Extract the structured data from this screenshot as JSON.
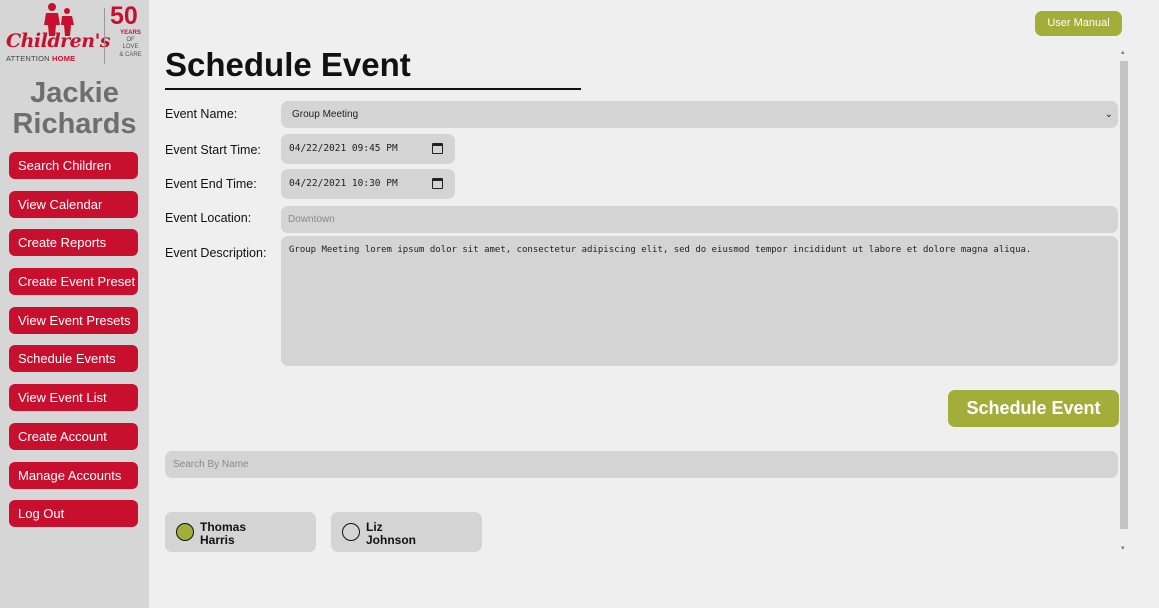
{
  "brand": {
    "script_name": "Children's",
    "attention": "ATTENTION",
    "home": "HOME",
    "fifty": "50",
    "years": "YEARS",
    "of_love": "OF LOVE",
    "and_care": "& CARE",
    "brand_color": "#c8102e"
  },
  "user": {
    "first": "Jackie",
    "last": "Richards"
  },
  "nav": [
    {
      "label": "Search Children"
    },
    {
      "label": "View Calendar"
    },
    {
      "label": "Create Reports"
    },
    {
      "label": "Create Event Preset"
    },
    {
      "label": "View Event Presets"
    },
    {
      "label": "Schedule Events"
    },
    {
      "label": "View Event List"
    },
    {
      "label": "Create Account"
    },
    {
      "label": "Manage Accounts"
    },
    {
      "label": "Log Out"
    }
  ],
  "header": {
    "user_manual_label": "User Manual"
  },
  "page": {
    "title": "Schedule Event"
  },
  "form": {
    "event_name_label": "Event Name:",
    "event_name_value": "Group Meeting",
    "start_label": "Event Start Time:",
    "start_value": "04/22/2021 09:45 PM",
    "end_label": "Event End Time:",
    "end_value": "04/22/2021 10:30 PM",
    "location_label": "Event Location:",
    "location_placeholder": "Downtown",
    "description_label": "Event Description:",
    "description_value": "Group Meeting lorem ipsum dolor sit amet, consectetur adipiscing elit, sed do eiusmod tempor incididunt ut labore et dolore magna aliqua.",
    "submit_label": "Schedule Event"
  },
  "search": {
    "placeholder": "Search By Name"
  },
  "children": [
    {
      "first": "Thomas",
      "last": "Harris",
      "selected": true
    },
    {
      "first": "Liz",
      "last": "Johnson",
      "selected": false
    }
  ],
  "colors": {
    "accent": "#a2ad3a",
    "nav": "#c8102e"
  }
}
